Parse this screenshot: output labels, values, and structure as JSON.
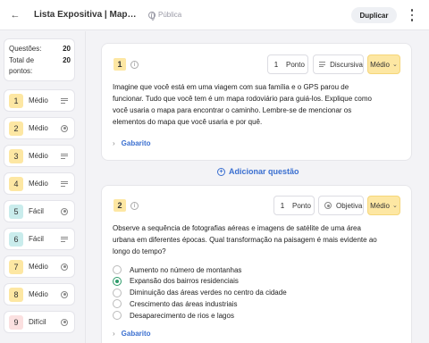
{
  "header": {
    "title": "Lista Expositiva | Mapas: Le...",
    "visibility": "Pública",
    "duplicate_label": "Duplicar"
  },
  "sidebar": {
    "stats": [
      {
        "label": "Questões:",
        "value": "20"
      },
      {
        "label": "Total de pontos:",
        "value": "20"
      }
    ],
    "items": [
      {
        "num": "1",
        "difficulty": "Médio",
        "type": "discursive",
        "color": "#fde7a3"
      },
      {
        "num": "2",
        "difficulty": "Médio",
        "type": "objective",
        "color": "#fde7a3"
      },
      {
        "num": "3",
        "difficulty": "Médio",
        "type": "discursive",
        "color": "#fde7a3"
      },
      {
        "num": "4",
        "difficulty": "Médio",
        "type": "discursive",
        "color": "#fde7a3"
      },
      {
        "num": "5",
        "difficulty": "Fácil",
        "type": "objective",
        "color": "#c9ecec"
      },
      {
        "num": "6",
        "difficulty": "Fácil",
        "type": "discursive",
        "color": "#c9ecec"
      },
      {
        "num": "7",
        "difficulty": "Médio",
        "type": "objective",
        "color": "#fde7a3"
      },
      {
        "num": "8",
        "difficulty": "Médio",
        "type": "objective",
        "color": "#fde7a3"
      },
      {
        "num": "9",
        "difficulty": "Difícil",
        "type": "objective",
        "color": "#fbe0e0"
      }
    ]
  },
  "questions": [
    {
      "num": "1",
      "points_value": "1",
      "points_label": "Ponto",
      "type_label": "Discursiva",
      "difficulty": "Médio",
      "text": "Imagine que você está em uma viagem com sua família e o GPS parou de funcionar. Tudo que você tem é um mapa rodoviário para guiá-los. Explique como você usaria o mapa para encontrar o caminho. Lembre-se de mencionar os elementos do mapa que você usaria e por quê.",
      "gabarito": "Gabarito"
    },
    {
      "num": "2",
      "points_value": "1",
      "points_label": "Ponto",
      "type_label": "Objetiva",
      "difficulty": "Médio",
      "text": "Observe a sequência de fotografias aéreas e imagens de satélite de uma área urbana em diferentes épocas. Qual transformação na paisagem é mais evidente ao longo do tempo?",
      "options": [
        "Aumento no número de montanhas",
        "Expansão dos bairros residenciais",
        "Diminuição das áreas verdes no centro da cidade",
        "Crescimento das áreas industriais",
        "Desaparecimento de rios e lagos"
      ],
      "selected_option": "Expansão dos bairros residenciais",
      "gabarito": "Gabarito"
    }
  ],
  "add_question_label": "Adicionar questão",
  "colors": {
    "accent": "#3a6fd0",
    "medium": "#fde7a3",
    "easy": "#c9ecec",
    "hard": "#fbe0e0",
    "selected": "#2f9c6a"
  }
}
